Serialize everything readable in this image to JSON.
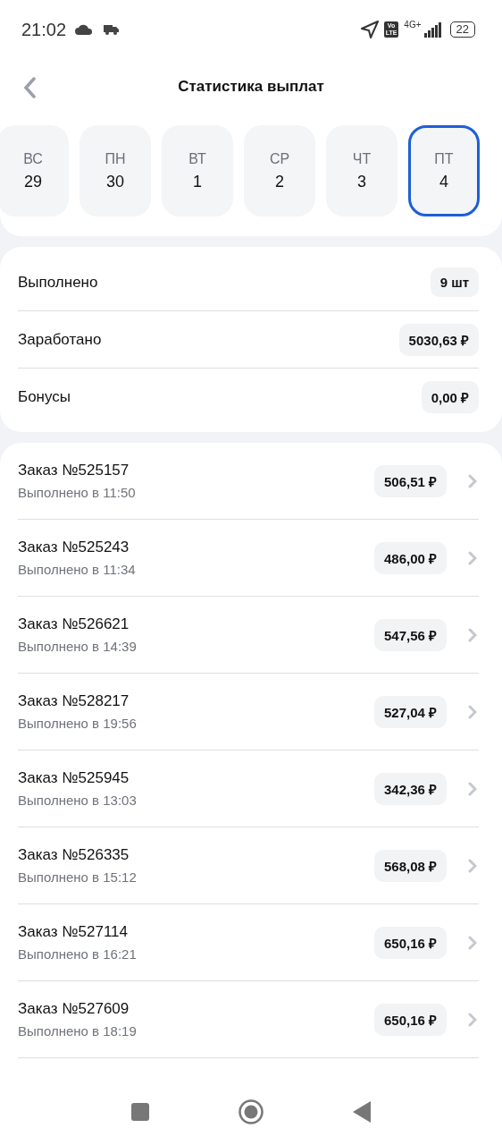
{
  "status_bar": {
    "time": "21:02",
    "volte": [
      "Vo",
      "LTE"
    ],
    "network": "4G+",
    "battery": "22"
  },
  "header": {
    "title": "Статистика выплат"
  },
  "days": [
    {
      "weekday": "ВС",
      "date": "29",
      "selected": false
    },
    {
      "weekday": "ПН",
      "date": "30",
      "selected": false
    },
    {
      "weekday": "ВТ",
      "date": "1",
      "selected": false
    },
    {
      "weekday": "СР",
      "date": "2",
      "selected": false
    },
    {
      "weekday": "ЧТ",
      "date": "3",
      "selected": false
    },
    {
      "weekday": "ПТ",
      "date": "4",
      "selected": true
    }
  ],
  "summary": [
    {
      "label": "Выполнено",
      "value": "9 шт"
    },
    {
      "label": "Заработано",
      "value": "5030,63 ₽"
    },
    {
      "label": "Бонусы",
      "value": "0,00 ₽"
    }
  ],
  "orders": [
    {
      "title": "Заказ №525157",
      "subtitle": "Выполнено в 11:50",
      "amount": "506,51 ₽"
    },
    {
      "title": "Заказ №525243",
      "subtitle": "Выполнено в 11:34",
      "amount": "486,00 ₽"
    },
    {
      "title": "Заказ №526621",
      "subtitle": "Выполнено в 14:39",
      "amount": "547,56 ₽"
    },
    {
      "title": "Заказ №528217",
      "subtitle": "Выполнено в 19:56",
      "amount": "527,04 ₽"
    },
    {
      "title": "Заказ №525945",
      "subtitle": "Выполнено в 13:03",
      "amount": "342,36 ₽"
    },
    {
      "title": "Заказ №526335",
      "subtitle": "Выполнено в 15:12",
      "amount": "568,08 ₽"
    },
    {
      "title": "Заказ №527114",
      "subtitle": "Выполнено в 16:21",
      "amount": "650,16 ₽"
    },
    {
      "title": "Заказ №527609",
      "subtitle": "Выполнено в 18:19",
      "amount": "650,16 ₽"
    }
  ]
}
